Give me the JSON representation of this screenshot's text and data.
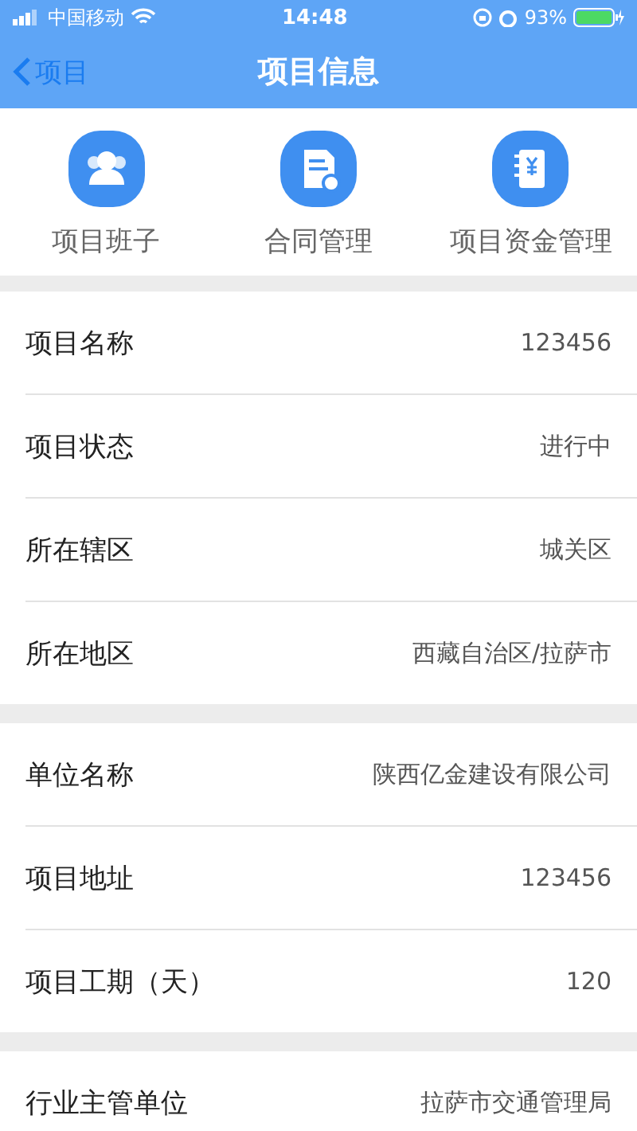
{
  "status_bar": {
    "carrier": "中国移动",
    "time": "14:48",
    "battery": "93%"
  },
  "nav": {
    "back": "项目",
    "title": "项目信息"
  },
  "shortcuts": [
    {
      "kind": "people",
      "label": "项目班子"
    },
    {
      "kind": "document",
      "label": "合同管理"
    },
    {
      "kind": "ledger",
      "label": "项目资金管理"
    }
  ],
  "sections": [
    [
      {
        "label": "项目名称",
        "value": "123456"
      },
      {
        "label": "项目状态",
        "value": "进行中"
      },
      {
        "label": "所在辖区",
        "value": "城关区"
      },
      {
        "label": "所在地区",
        "value": "西藏自治区/拉萨市"
      }
    ],
    [
      {
        "label": "单位名称",
        "value": "陕西亿金建设有限公司"
      },
      {
        "label": "项目地址",
        "value": "123456"
      },
      {
        "label": "项目工期（天）",
        "value": "120"
      }
    ],
    [
      {
        "label": "行业主管单位",
        "value": "拉萨市交通管理局"
      }
    ]
  ]
}
